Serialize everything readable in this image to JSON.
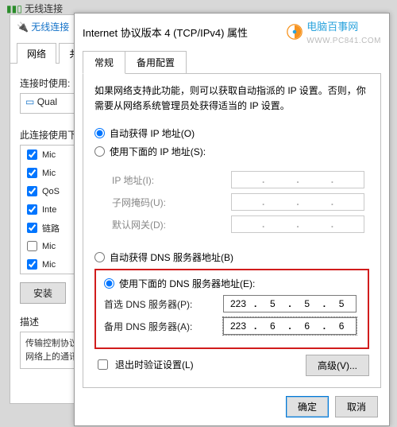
{
  "bg": {
    "topTitle": "无线连接",
    "winTitle": "无线连接",
    "tab1": "网络",
    "tab2": "共享",
    "connLabel": "连接时使用:",
    "adapter": "Qual",
    "serviceLabel": "此连接使用下",
    "items": [
      "Mic",
      "Mic",
      "QoS",
      "Inte",
      "链路",
      "Mic",
      "Mic"
    ],
    "btnInstall": "安装",
    "descLabel": "描述",
    "descText": "传输控制协议/Internet 协议。该协议是默认的广域网络协议，它提供在不同的相互连接的网络上的通讯。"
  },
  "brand": {
    "name": "电脑百事网",
    "url": "WWW.PC841.COM"
  },
  "dlg": {
    "title": "Internet 协议版本 4 (TCP/IPv4) 属性",
    "tabGeneral": "常规",
    "tabAlt": "备用配置",
    "info": "如果网络支持此功能，则可以获取自动指派的 IP 设置。否则，你需要从网络系统管理员处获得适当的 IP 设置。",
    "rAutoIp": "自动获得 IP 地址(O)",
    "rManualIp": "使用下面的 IP 地址(S):",
    "lblIp": "IP 地址(I):",
    "lblMask": "子网掩码(U):",
    "lblGw": "默认网关(D):",
    "rAutoDns": "自动获得 DNS 服务器地址(B)",
    "rManualDns": "使用下面的 DNS 服务器地址(E):",
    "lblDns1": "首选 DNS 服务器(P):",
    "lblDns2": "备用 DNS 服务器(A):",
    "dns1": [
      "223",
      "5",
      "5",
      "5"
    ],
    "dns2": [
      "223",
      "6",
      "6",
      "6"
    ],
    "chkValidate": "退出时验证设置(L)",
    "btnAdv": "高级(V)...",
    "btnOk": "确定",
    "btnCancel": "取消"
  }
}
